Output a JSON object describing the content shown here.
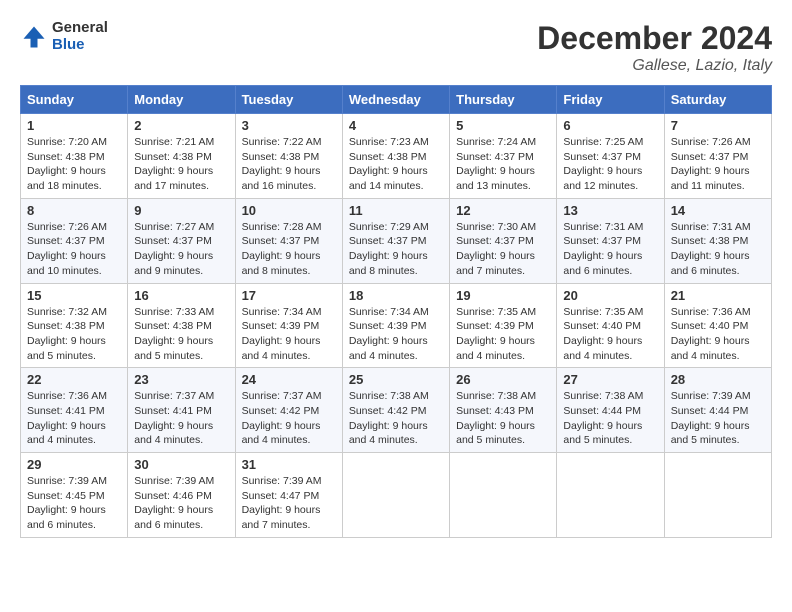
{
  "header": {
    "logo_line1": "General",
    "logo_line2": "Blue",
    "month": "December 2024",
    "location": "Gallese, Lazio, Italy"
  },
  "weekdays": [
    "Sunday",
    "Monday",
    "Tuesday",
    "Wednesday",
    "Thursday",
    "Friday",
    "Saturday"
  ],
  "weeks": [
    [
      {
        "day": "1",
        "sunrise": "Sunrise: 7:20 AM",
        "sunset": "Sunset: 4:38 PM",
        "daylight": "Daylight: 9 hours and 18 minutes."
      },
      {
        "day": "2",
        "sunrise": "Sunrise: 7:21 AM",
        "sunset": "Sunset: 4:38 PM",
        "daylight": "Daylight: 9 hours and 17 minutes."
      },
      {
        "day": "3",
        "sunrise": "Sunrise: 7:22 AM",
        "sunset": "Sunset: 4:38 PM",
        "daylight": "Daylight: 9 hours and 16 minutes."
      },
      {
        "day": "4",
        "sunrise": "Sunrise: 7:23 AM",
        "sunset": "Sunset: 4:38 PM",
        "daylight": "Daylight: 9 hours and 14 minutes."
      },
      {
        "day": "5",
        "sunrise": "Sunrise: 7:24 AM",
        "sunset": "Sunset: 4:37 PM",
        "daylight": "Daylight: 9 hours and 13 minutes."
      },
      {
        "day": "6",
        "sunrise": "Sunrise: 7:25 AM",
        "sunset": "Sunset: 4:37 PM",
        "daylight": "Daylight: 9 hours and 12 minutes."
      },
      {
        "day": "7",
        "sunrise": "Sunrise: 7:26 AM",
        "sunset": "Sunset: 4:37 PM",
        "daylight": "Daylight: 9 hours and 11 minutes."
      }
    ],
    [
      {
        "day": "8",
        "sunrise": "Sunrise: 7:26 AM",
        "sunset": "Sunset: 4:37 PM",
        "daylight": "Daylight: 9 hours and 10 minutes."
      },
      {
        "day": "9",
        "sunrise": "Sunrise: 7:27 AM",
        "sunset": "Sunset: 4:37 PM",
        "daylight": "Daylight: 9 hours and 9 minutes."
      },
      {
        "day": "10",
        "sunrise": "Sunrise: 7:28 AM",
        "sunset": "Sunset: 4:37 PM",
        "daylight": "Daylight: 9 hours and 8 minutes."
      },
      {
        "day": "11",
        "sunrise": "Sunrise: 7:29 AM",
        "sunset": "Sunset: 4:37 PM",
        "daylight": "Daylight: 9 hours and 8 minutes."
      },
      {
        "day": "12",
        "sunrise": "Sunrise: 7:30 AM",
        "sunset": "Sunset: 4:37 PM",
        "daylight": "Daylight: 9 hours and 7 minutes."
      },
      {
        "day": "13",
        "sunrise": "Sunrise: 7:31 AM",
        "sunset": "Sunset: 4:37 PM",
        "daylight": "Daylight: 9 hours and 6 minutes."
      },
      {
        "day": "14",
        "sunrise": "Sunrise: 7:31 AM",
        "sunset": "Sunset: 4:38 PM",
        "daylight": "Daylight: 9 hours and 6 minutes."
      }
    ],
    [
      {
        "day": "15",
        "sunrise": "Sunrise: 7:32 AM",
        "sunset": "Sunset: 4:38 PM",
        "daylight": "Daylight: 9 hours and 5 minutes."
      },
      {
        "day": "16",
        "sunrise": "Sunrise: 7:33 AM",
        "sunset": "Sunset: 4:38 PM",
        "daylight": "Daylight: 9 hours and 5 minutes."
      },
      {
        "day": "17",
        "sunrise": "Sunrise: 7:34 AM",
        "sunset": "Sunset: 4:39 PM",
        "daylight": "Daylight: 9 hours and 4 minutes."
      },
      {
        "day": "18",
        "sunrise": "Sunrise: 7:34 AM",
        "sunset": "Sunset: 4:39 PM",
        "daylight": "Daylight: 9 hours and 4 minutes."
      },
      {
        "day": "19",
        "sunrise": "Sunrise: 7:35 AM",
        "sunset": "Sunset: 4:39 PM",
        "daylight": "Daylight: 9 hours and 4 minutes."
      },
      {
        "day": "20",
        "sunrise": "Sunrise: 7:35 AM",
        "sunset": "Sunset: 4:40 PM",
        "daylight": "Daylight: 9 hours and 4 minutes."
      },
      {
        "day": "21",
        "sunrise": "Sunrise: 7:36 AM",
        "sunset": "Sunset: 4:40 PM",
        "daylight": "Daylight: 9 hours and 4 minutes."
      }
    ],
    [
      {
        "day": "22",
        "sunrise": "Sunrise: 7:36 AM",
        "sunset": "Sunset: 4:41 PM",
        "daylight": "Daylight: 9 hours and 4 minutes."
      },
      {
        "day": "23",
        "sunrise": "Sunrise: 7:37 AM",
        "sunset": "Sunset: 4:41 PM",
        "daylight": "Daylight: 9 hours and 4 minutes."
      },
      {
        "day": "24",
        "sunrise": "Sunrise: 7:37 AM",
        "sunset": "Sunset: 4:42 PM",
        "daylight": "Daylight: 9 hours and 4 minutes."
      },
      {
        "day": "25",
        "sunrise": "Sunrise: 7:38 AM",
        "sunset": "Sunset: 4:42 PM",
        "daylight": "Daylight: 9 hours and 4 minutes."
      },
      {
        "day": "26",
        "sunrise": "Sunrise: 7:38 AM",
        "sunset": "Sunset: 4:43 PM",
        "daylight": "Daylight: 9 hours and 5 minutes."
      },
      {
        "day": "27",
        "sunrise": "Sunrise: 7:38 AM",
        "sunset": "Sunset: 4:44 PM",
        "daylight": "Daylight: 9 hours and 5 minutes."
      },
      {
        "day": "28",
        "sunrise": "Sunrise: 7:39 AM",
        "sunset": "Sunset: 4:44 PM",
        "daylight": "Daylight: 9 hours and 5 minutes."
      }
    ],
    [
      {
        "day": "29",
        "sunrise": "Sunrise: 7:39 AM",
        "sunset": "Sunset: 4:45 PM",
        "daylight": "Daylight: 9 hours and 6 minutes."
      },
      {
        "day": "30",
        "sunrise": "Sunrise: 7:39 AM",
        "sunset": "Sunset: 4:46 PM",
        "daylight": "Daylight: 9 hours and 6 minutes."
      },
      {
        "day": "31",
        "sunrise": "Sunrise: 7:39 AM",
        "sunset": "Sunset: 4:47 PM",
        "daylight": "Daylight: 9 hours and 7 minutes."
      },
      null,
      null,
      null,
      null
    ]
  ]
}
